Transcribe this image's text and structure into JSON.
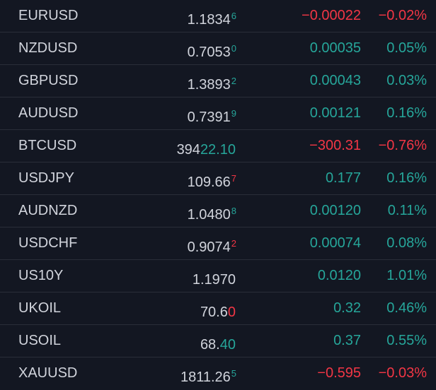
{
  "colors": {
    "background": "#131722",
    "text": "#d1d4dc",
    "up": "#26a69a",
    "down": "#f23645",
    "divider": "#2a2e39"
  },
  "rows": [
    {
      "symbol": "EURUSD",
      "last_base": "1.1834",
      "last_frac": "",
      "last_pip": "6",
      "pip_dir": "up",
      "frac_dir": "flat",
      "change": "−0.00022",
      "change_pct": "−0.02%",
      "dir": "down"
    },
    {
      "symbol": "NZDUSD",
      "last_base": "0.7053",
      "last_frac": "",
      "last_pip": "0",
      "pip_dir": "up",
      "frac_dir": "flat",
      "change": "0.00035",
      "change_pct": "0.05%",
      "dir": "up"
    },
    {
      "symbol": "GBPUSD",
      "last_base": "1.3893",
      "last_frac": "",
      "last_pip": "2",
      "pip_dir": "up",
      "frac_dir": "flat",
      "change": "0.00043",
      "change_pct": "0.03%",
      "dir": "up"
    },
    {
      "symbol": "AUDUSD",
      "last_base": "0.7391",
      "last_frac": "",
      "last_pip": "9",
      "pip_dir": "up",
      "frac_dir": "flat",
      "change": "0.00121",
      "change_pct": "0.16%",
      "dir": "up"
    },
    {
      "symbol": "BTCUSD",
      "last_base": "394",
      "last_frac": "22.10",
      "last_pip": "",
      "pip_dir": "up",
      "frac_dir": "up",
      "change": "−300.31",
      "change_pct": "−0.76%",
      "dir": "down"
    },
    {
      "symbol": "USDJPY",
      "last_base": "109.66",
      "last_frac": "",
      "last_pip": "7",
      "pip_dir": "down",
      "frac_dir": "flat",
      "change": "0.177",
      "change_pct": "0.16%",
      "dir": "up"
    },
    {
      "symbol": "AUDNZD",
      "last_base": "1.0480",
      "last_frac": "",
      "last_pip": "8",
      "pip_dir": "up",
      "frac_dir": "flat",
      "change": "0.00120",
      "change_pct": "0.11%",
      "dir": "up"
    },
    {
      "symbol": "USDCHF",
      "last_base": "0.9074",
      "last_frac": "",
      "last_pip": "2",
      "pip_dir": "down",
      "frac_dir": "flat",
      "change": "0.00074",
      "change_pct": "0.08%",
      "dir": "up"
    },
    {
      "symbol": "US10Y",
      "last_base": "1.1970",
      "last_frac": "",
      "last_pip": "",
      "pip_dir": "flat",
      "frac_dir": "flat",
      "change": "0.0120",
      "change_pct": "1.01%",
      "dir": "up"
    },
    {
      "symbol": "UKOIL",
      "last_base": "70.6",
      "last_frac": "0",
      "last_pip": "",
      "pip_dir": "flat",
      "frac_dir": "down",
      "change": "0.32",
      "change_pct": "0.46%",
      "dir": "up"
    },
    {
      "symbol": "USOIL",
      "last_base": "68.",
      "last_frac": "40",
      "last_pip": "",
      "pip_dir": "flat",
      "frac_dir": "up",
      "change": "0.37",
      "change_pct": "0.55%",
      "dir": "up"
    },
    {
      "symbol": "XAUUSD",
      "last_base": "1811.26",
      "last_frac": "",
      "last_pip": "5",
      "pip_dir": "up",
      "frac_dir": "flat",
      "change": "−0.595",
      "change_pct": "−0.03%",
      "dir": "down"
    }
  ]
}
